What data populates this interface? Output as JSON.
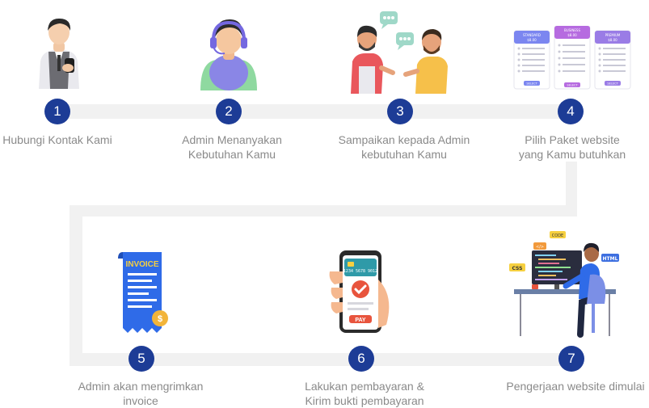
{
  "colors": {
    "step_circle": "#1d3c96",
    "connector": "#f1f1f1",
    "label_text": "#8a8a8a"
  },
  "steps": [
    {
      "number": "1",
      "label_lines": [
        "Hubungi Kontak Kami"
      ],
      "icon": "person-phone-icon"
    },
    {
      "number": "2",
      "label_lines": [
        "Admin Menanyakan",
        "Kebutuhan Kamu"
      ],
      "icon": "admin-headset-icon"
    },
    {
      "number": "3",
      "label_lines": [
        "Sampaikan kepada Admin",
        "kebutuhan Kamu"
      ],
      "icon": "conversation-icon"
    },
    {
      "number": "4",
      "label_lines": [
        "Pilih Paket website",
        "yang Kamu butuhkan"
      ],
      "icon": "pricing-table-icon"
    },
    {
      "number": "5",
      "label_lines": [
        "Admin akan mengrimkan",
        "invoice"
      ],
      "icon": "invoice-icon"
    },
    {
      "number": "6",
      "label_lines": [
        "Lakukan pembayaran &",
        "Kirim bukti pembayaran"
      ],
      "icon": "mobile-payment-icon"
    },
    {
      "number": "7",
      "label_lines": [
        "Pengerjaan website dimulai"
      ],
      "icon": "developer-icon"
    }
  ],
  "illustration_text": {
    "pricing_plans": [
      "STANDARD",
      "BUSINESS",
      "PREMIUM"
    ],
    "pricing_prices": [
      "$8.00",
      "$8.00",
      "$8.00"
    ],
    "pricing_button": "SELECT",
    "invoice_title": "INVOICE",
    "pay_button": "PAY",
    "card_number": "1234 5678 9012",
    "dev_tags": [
      "</>",
      "CODE",
      "HTML",
      "CSS"
    ]
  }
}
